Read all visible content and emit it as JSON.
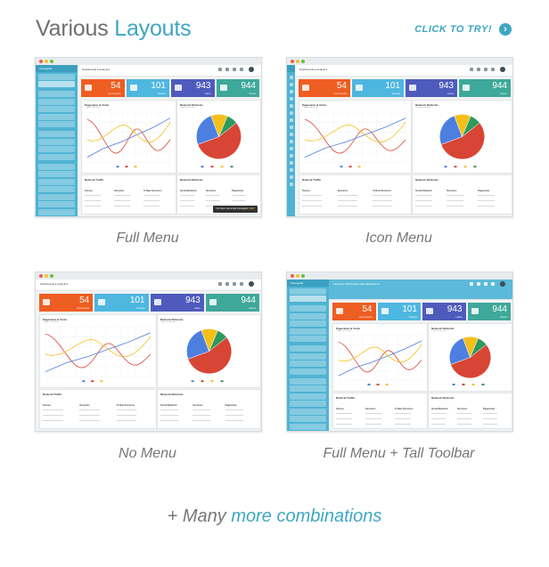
{
  "header": {
    "title_plain": "Various ",
    "title_accent": "Layouts",
    "cta_label": "CLICK TO TRY!",
    "cta_icon": "chevron-right-icon"
  },
  "colors": {
    "accent": "#3ea6c4",
    "sidebar": "#4fb3d3",
    "tile_orange": "#ee5d22",
    "tile_blue": "#4eb7e0",
    "tile_indigo": "#4e5bbd",
    "tile_teal": "#3ea89a",
    "series_red": "#d84535",
    "series_blue": "#4c7fe0",
    "series_yellow": "#f3c01a",
    "series_green": "#2e9a5b"
  },
  "dashboard": {
    "breadcrumb": "Dashboards ▸ Analytics",
    "breadcrumb_tall": "Layouts ▸ Tall Toolbar with background",
    "brand": "Averagular",
    "tiles": [
      {
        "icon": "comment-icon",
        "value": "54",
        "label": "Comments"
      },
      {
        "icon": "twitter-icon",
        "value": "101",
        "label": "Tweets"
      },
      {
        "icon": "facebook-icon",
        "value": "943",
        "label": "Likes"
      },
      {
        "icon": "eye-icon",
        "value": "944",
        "label": "Views"
      }
    ],
    "line_card": {
      "title": "Pageviews & Visits",
      "subtitle": "7 days in the past"
    },
    "pie_card": {
      "title": "Network Referrals",
      "subtitle": "7 days in the past"
    },
    "traffic_card": {
      "title": "Referral Traffic",
      "headers": [
        "Source",
        "Sessions",
        "% New Sessions"
      ]
    },
    "network_card": {
      "title": "Network Referrals",
      "headers": [
        "Social Network",
        "Sessions",
        "Pageviews"
      ]
    },
    "toast": "You have new email messages!",
    "toast_action": "VIEW"
  },
  "layouts": [
    {
      "caption": "Full Menu"
    },
    {
      "caption": "Icon Menu"
    },
    {
      "caption": "No Menu"
    },
    {
      "caption": "Full Menu + Tall Toolbar"
    }
  ],
  "footer": {
    "plain": "+ Many ",
    "accent": "more combinations"
  }
}
